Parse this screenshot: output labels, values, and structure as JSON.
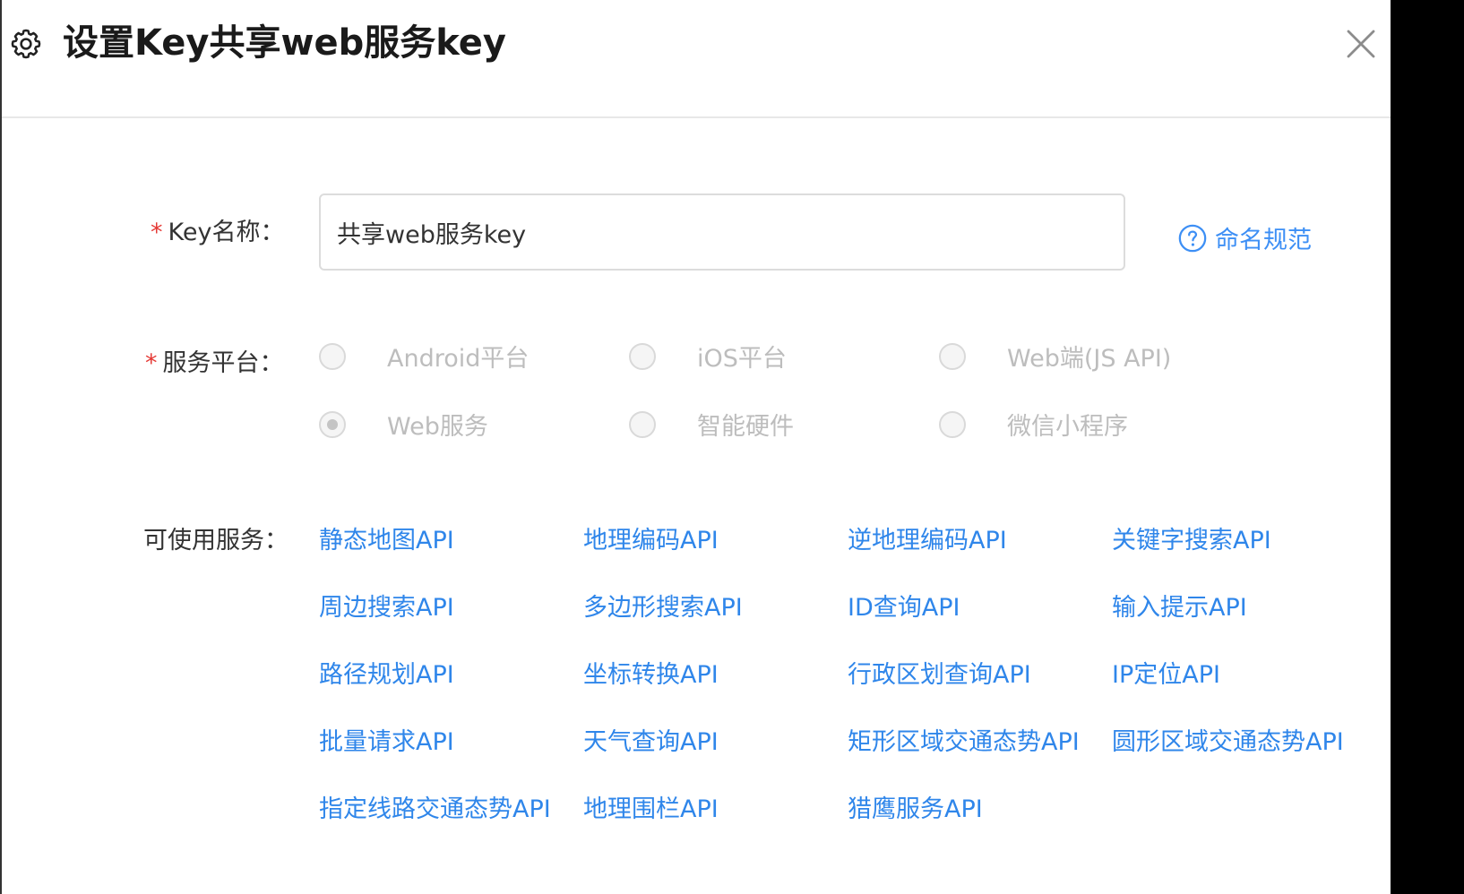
{
  "dialog": {
    "title": "设置Key共享web服务key"
  },
  "form": {
    "key_name_label": "Key名称：",
    "key_name_value": "共享web服务key",
    "naming_rule_link": "命名规范",
    "platform_label": "服务平台：",
    "required_mark": "*",
    "platforms": [
      {
        "label": "Android平台",
        "checked": false
      },
      {
        "label": "iOS平台",
        "checked": false
      },
      {
        "label": "Web端(JS API)",
        "checked": false
      },
      {
        "label": "Web服务",
        "checked": true
      },
      {
        "label": "智能硬件",
        "checked": false
      },
      {
        "label": "微信小程序",
        "checked": false
      }
    ],
    "services_label": "可使用服务：",
    "services": [
      "静态地图API",
      "地理编码API",
      "逆地理编码API",
      "关键字搜索API",
      "周边搜索API",
      "多边形搜索API",
      "ID查询API",
      "输入提示API",
      "路径规划API",
      "坐标转换API",
      "行政区划查询API",
      "IP定位API",
      "批量请求API",
      "天气查询API",
      "矩形区域交通态势API",
      "圆形区域交通态势API",
      "指定线路交通态势API",
      "地理围栏API",
      "猎鹰服务API"
    ]
  },
  "colors": {
    "link": "#2f86ea",
    "required": "#e53935",
    "disabled_text": "#bdbdbd"
  },
  "icons": {
    "settings": "gear-icon",
    "close": "close-icon",
    "help": "question-circle-icon"
  }
}
